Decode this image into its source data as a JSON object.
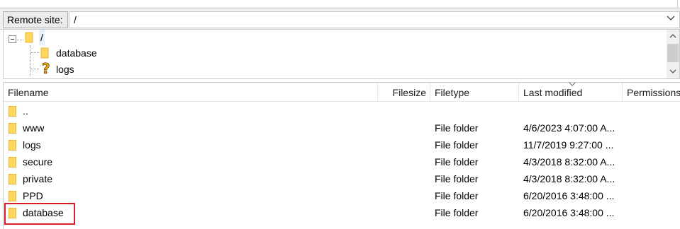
{
  "remote": {
    "label": "Remote site:",
    "path": "/"
  },
  "tree": {
    "root": "/",
    "children": [
      {
        "label": "database",
        "icon": "folder-icon"
      },
      {
        "label": "logs",
        "icon": "unknown-folder-icon"
      }
    ]
  },
  "columns": {
    "filename": "Filename",
    "filesize": "Filesize",
    "filetype": "Filetype",
    "last_modified": "Last modified",
    "permissions": "Permissions"
  },
  "files": [
    {
      "name": "..",
      "size": "",
      "type": "",
      "modified": ""
    },
    {
      "name": "www",
      "size": "",
      "type": "File folder",
      "modified": "4/6/2023 4:07:00 A..."
    },
    {
      "name": "logs",
      "size": "",
      "type": "File folder",
      "modified": "11/7/2019 9:27:00 ..."
    },
    {
      "name": "secure",
      "size": "",
      "type": "File folder",
      "modified": "4/3/2018 8:32:00 A..."
    },
    {
      "name": "private",
      "size": "",
      "type": "File folder",
      "modified": "4/3/2018 8:32:00 A..."
    },
    {
      "name": "PPD",
      "size": "",
      "type": "File folder",
      "modified": "6/20/2016 3:48:00 ..."
    },
    {
      "name": "database",
      "size": "",
      "type": "File folder",
      "modified": "6/20/2016 3:48:00 ..."
    }
  ],
  "highlighted_file": "database",
  "colors": {
    "folder": "#ffd75e",
    "folder_dark": "#e8b53a",
    "highlight": "#d6202b",
    "unknown": "#f0a500"
  }
}
